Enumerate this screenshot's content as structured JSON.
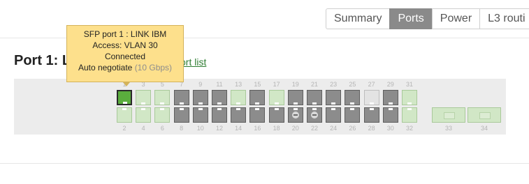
{
  "tabs": [
    {
      "label": "Summary",
      "active": false
    },
    {
      "label": "Ports",
      "active": true
    },
    {
      "label": "Power",
      "active": false
    },
    {
      "label": "L3 routi",
      "active": false
    }
  ],
  "heading": "Port 1: L",
  "port_list_link": "ort list",
  "tooltip": {
    "line1": "SFP port 1 : LINK IBM",
    "line2": "Access: VLAN 30",
    "line3": "Connected",
    "line4_main": "Auto negotiate",
    "line4_speed": "(10 Gbps)"
  },
  "switch": {
    "top_labels": [
      "1",
      "3",
      "5",
      "7",
      "9",
      "11",
      "13",
      "15",
      "17",
      "19",
      "21",
      "23",
      "25",
      "27",
      "29",
      "31"
    ],
    "bottom_labels": [
      "2",
      "4",
      "6",
      "8",
      "10",
      "12",
      "14",
      "16",
      "18",
      "20",
      "22",
      "24",
      "26",
      "28",
      "30",
      "32",
      "33",
      "34"
    ],
    "top_ports": [
      "active",
      "green",
      "green",
      "gray",
      "gray",
      "gray",
      "green",
      "gray",
      "green",
      "gray",
      "gray",
      "gray",
      "gray",
      "light",
      "gray",
      "green"
    ],
    "bottom_ports": [
      "green",
      "green",
      "green",
      "gray",
      "gray",
      "gray",
      "gray",
      "gray",
      "gray",
      "blocked",
      "blocked",
      "gray",
      "gray",
      "gray",
      "gray",
      "green"
    ],
    "sfp_ports": [
      "33",
      "34"
    ]
  }
}
